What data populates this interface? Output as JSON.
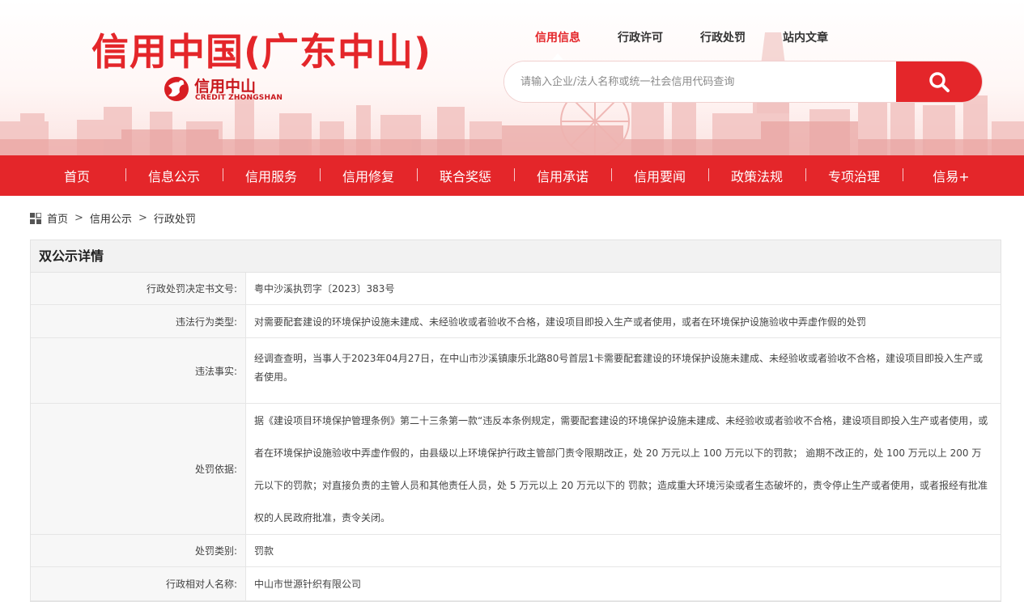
{
  "header": {
    "site_title": "信用中国(广东中山)",
    "logo_cn": "信用中山",
    "logo_en": "CREDIT ZHONGSHAN",
    "top_nav": [
      {
        "label": "信用信息",
        "active": true
      },
      {
        "label": "行政许可",
        "active": false
      },
      {
        "label": "行政处罚",
        "active": false
      },
      {
        "label": "站内文章",
        "active": false
      }
    ],
    "search": {
      "placeholder": "请输入企业/法人名称或统一社会信用代码查询",
      "button_icon": "search-icon"
    }
  },
  "main_nav": [
    "首页",
    "信息公示",
    "信用服务",
    "信用修复",
    "联合奖惩",
    "信用承诺",
    "信用要闻",
    "政策法规",
    "专项治理",
    "信易+"
  ],
  "breadcrumb": {
    "icon": "grid-icon",
    "items": [
      "首页",
      "信用公示",
      "行政处罚"
    ],
    "separator": ">"
  },
  "detail": {
    "title": "双公示详情",
    "rows": [
      {
        "label": "行政处罚决定书文号:",
        "value": "粤中沙溪执罚字〔2023〕383号"
      },
      {
        "label": "违法行为类型:",
        "value": "对需要配套建设的环境保护设施未建成、未经验收或者验收不合格，建设项目即投入生产或者使用，或者在环境保护设施验收中弄虚作假的处罚"
      },
      {
        "label": "违法事实:",
        "value": "经调查查明，当事人于2023年04月27日，在中山市沙溪镇康乐北路80号首层1卡需要配套建设的环境保护设施未建成、未经验收或者验收不合格，建设项目即投入生产或者使用。"
      },
      {
        "label": "处罚依据:",
        "value": "据《建设项目环境保护管理条例》第二十三条第一款“违反本条例规定，需要配套建设的环境保护设施未建成、未经验收或者验收不合格，建设项目即投入生产或者使用，或者在环境保护设施验收中弄虚作假的，由县级以上环境保护行政主管部门责令限期改正，处 20 万元以上 100 万元以下的罚款； 逾期不改正的，处 100 万元以上 200 万元以下的罚款；对直接负责的主管人员和其他责任人员，处 5 万元以上 20 万元以下的 罚款；造成重大环境污染或者生态破坏的，责令停止生产或者使用，或者报经有批准权的人民政府批准，责令关闭。"
      },
      {
        "label": "处罚类别:",
        "value": "罚款"
      },
      {
        "label": "行政相对人名称:",
        "value": "中山市世源针织有限公司"
      }
    ]
  },
  "colors": {
    "brand_red": "#e4262a",
    "label_bg": "#f7f7f7",
    "head_bg": "#f2f2f2"
  }
}
